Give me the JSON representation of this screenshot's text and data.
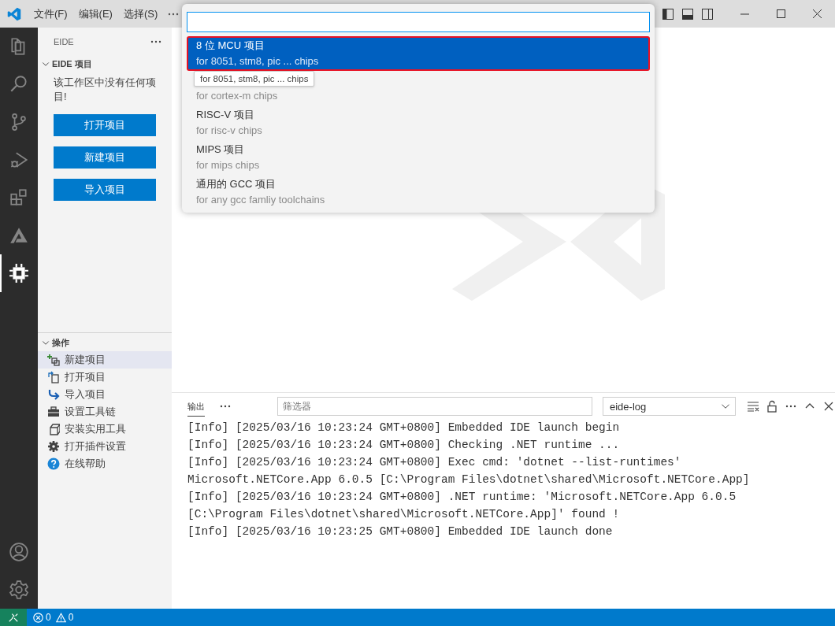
{
  "title_bar": {
    "menus": [
      "文件(F)",
      "编辑(E)",
      "选择(S)"
    ]
  },
  "activity_bar": {
    "items": [
      {
        "kind": "files",
        "selected": false
      },
      {
        "kind": "search",
        "selected": false
      },
      {
        "kind": "source-control",
        "selected": false
      },
      {
        "kind": "run-debug",
        "selected": false
      },
      {
        "kind": "extensions",
        "selected": false
      },
      {
        "kind": "triangle",
        "selected": false
      },
      {
        "kind": "chip",
        "selected": true
      }
    ],
    "bottom": [
      {
        "kind": "account"
      },
      {
        "kind": "settings"
      }
    ]
  },
  "sidebar": {
    "title": "EIDE",
    "projects": {
      "title": "EIDE 项目",
      "expanded": true,
      "message": "该工作区中没有任何项目!",
      "buttons": [
        "打开项目",
        "新建项目",
        "导入项目"
      ]
    },
    "actions": {
      "title": "操作",
      "expanded": true,
      "items": [
        {
          "label": "新建项目",
          "kind": "new",
          "selected": true
        },
        {
          "label": "打开项目",
          "kind": "open",
          "selected": false
        },
        {
          "label": "导入项目",
          "kind": "import",
          "selected": false
        },
        {
          "label": "设置工具链",
          "kind": "toolbox",
          "selected": false
        },
        {
          "label": "安装实用工具",
          "kind": "install",
          "selected": false
        },
        {
          "label": "打开插件设置",
          "kind": "gear",
          "selected": false
        },
        {
          "label": "在线帮助",
          "kind": "help",
          "selected": false
        }
      ]
    }
  },
  "quick_pick": {
    "items": [
      {
        "label": "8 位 MCU 项目",
        "detail": "for 8051, stm8, pic ... chips",
        "selected": true
      },
      {
        "detail": "for cortex-m chips",
        "selected": false
      },
      {
        "label": "RISC-V 项目",
        "detail": "for risc-v chips",
        "selected": false
      },
      {
        "label": "MIPS 项目",
        "detail": "for mips chips",
        "selected": false
      },
      {
        "label": "通用的 GCC 项目",
        "detail": "for any gcc famliy toolchains",
        "selected": false
      }
    ],
    "tooltip": "for 8051, stm8, pic ... chips"
  },
  "panel": {
    "tabs": [
      {
        "label": "输出",
        "selected": true
      }
    ],
    "filter": {
      "placeholder": "筛选器"
    },
    "channel": "eide-log",
    "log_lines": [
      "[Info] [2025/03/16 10:23:24 GMT+0800] Embedded IDE launch begin",
      "[Info] [2025/03/16 10:23:24 GMT+0800] Checking .NET runtime ...",
      "[Info] [2025/03/16 10:23:24 GMT+0800] Exec cmd: 'dotnet --list-runtimes'",
      "Microsoft.NETCore.App 6.0.5 [C:\\Program Files\\dotnet\\shared\\Microsoft.NETCore.App]",
      "[Info] [2025/03/16 10:23:24 GMT+0800] .NET runtime: 'Microsoft.NETCore.App 6.0.5",
      "[C:\\Program Files\\dotnet\\shared\\Microsoft.NETCore.App]' found !",
      "[Info] [2025/03/16 10:23:25 GMT+0800] Embedded IDE launch done"
    ]
  },
  "status_bar": {
    "errors": "0",
    "warnings": "0"
  }
}
